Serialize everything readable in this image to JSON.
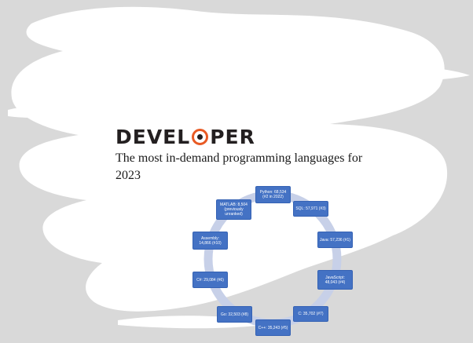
{
  "brand": {
    "logo_left": "DEVEL",
    "logo_right": "PER"
  },
  "headline": {
    "line1": "The most in-demand programming languages for",
    "line2": "2023"
  },
  "colors": {
    "background": "#d9d9d9",
    "brush": "#ffffff",
    "node_fill": "#4472c4",
    "ring": "#c7d0e8",
    "logo_accent": "#e85a24"
  },
  "cycle": {
    "nodes": [
      {
        "id": "python",
        "label": "Python: 68,534 (#2 in 2022)"
      },
      {
        "id": "sql",
        "label": "SQL: 57,971 (#3)"
      },
      {
        "id": "java",
        "label": "Java: 57,236 (#1)"
      },
      {
        "id": "javascript",
        "label": "JavaScript: 48,043 (#4)"
      },
      {
        "id": "c",
        "label": "C: 35,702 (#7)"
      },
      {
        "id": "cpp",
        "label": "C++: 35,243 (#5)"
      },
      {
        "id": "go",
        "label": "Go: 32,503 (#8)"
      },
      {
        "id": "csharp",
        "label": "C#: 29,084 (#6)"
      },
      {
        "id": "assembly",
        "label": "Assembly: 14,866 (#10)"
      },
      {
        "id": "matlab",
        "label": "MATLAB: 8,504 (previously unranked)"
      }
    ]
  }
}
